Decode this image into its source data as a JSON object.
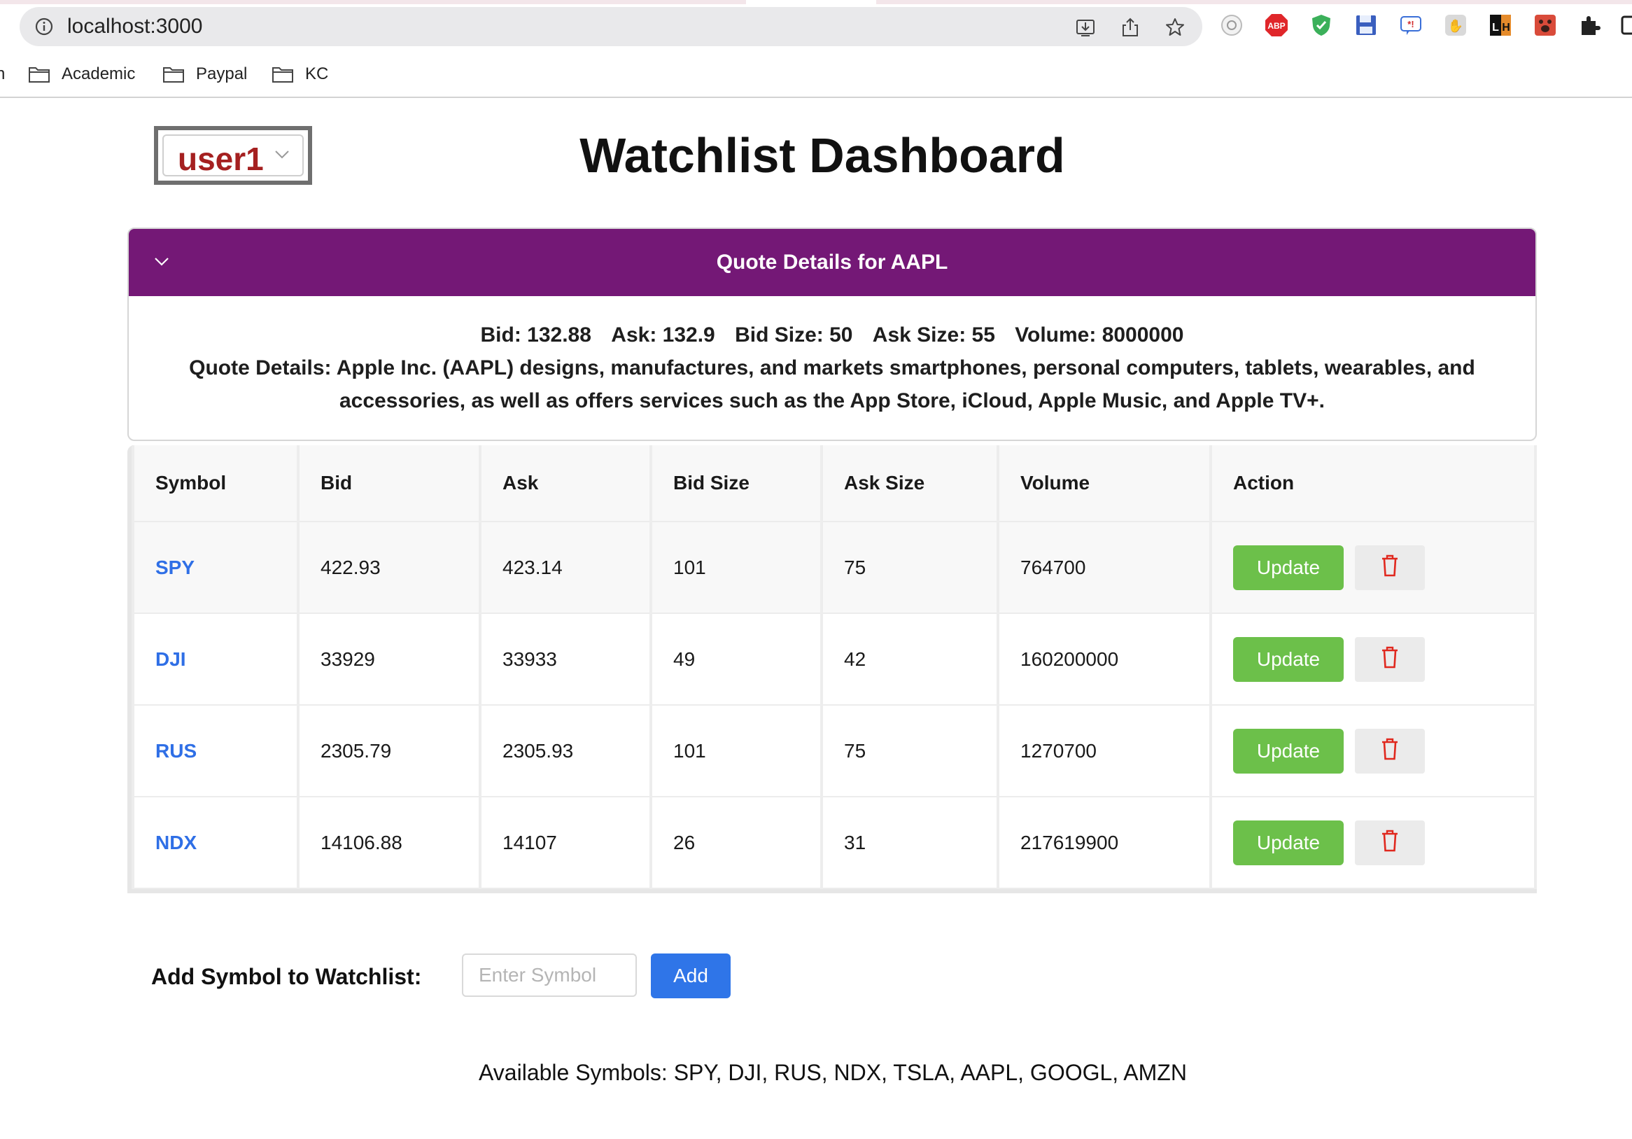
{
  "browser": {
    "url": "localhost:3000",
    "bookmarks": [
      {
        "label": "n"
      },
      {
        "label": "Academic"
      },
      {
        "label": "Paypal"
      },
      {
        "label": "KC"
      }
    ],
    "extensions": [
      "timer-icon",
      "adblock-icon",
      "shield-icon",
      "save-icon",
      "bookmark-star-icon",
      "hand-icon",
      "lighthouse-icon",
      "paw-icon",
      "puzzle-icon",
      "window-icon"
    ]
  },
  "page": {
    "user_select": {
      "value": "user1"
    },
    "title": "Watchlist Dashboard"
  },
  "quote_panel": {
    "title": "Quote Details for AAPL",
    "bid": "Bid: 132.88",
    "ask": "Ask: 132.9",
    "bid_size": "Bid Size: 50",
    "ask_size": "Ask Size: 55",
    "volume": "Volume: 8000000",
    "details": "Quote Details: Apple Inc. (AAPL) designs, manufactures, and markets smartphones, personal computers, tablets, wearables, and accessories, as well as offers services such as the App Store, iCloud, Apple Music, and Apple TV+."
  },
  "table": {
    "headers": [
      "Symbol",
      "Bid",
      "Ask",
      "Bid Size",
      "Ask Size",
      "Volume",
      "Action"
    ],
    "update_label": "Update",
    "rows": [
      {
        "symbol": "SPY",
        "bid": "422.93",
        "ask": "423.14",
        "bid_size": "101",
        "ask_size": "75",
        "volume": "764700"
      },
      {
        "symbol": "DJI",
        "bid": "33929",
        "ask": "33933",
        "bid_size": "49",
        "ask_size": "42",
        "volume": "160200000"
      },
      {
        "symbol": "RUS",
        "bid": "2305.79",
        "ask": "2305.93",
        "bid_size": "101",
        "ask_size": "75",
        "volume": "1270700"
      },
      {
        "symbol": "NDX",
        "bid": "14106.88",
        "ask": "14107",
        "bid_size": "26",
        "ask_size": "31",
        "volume": "217619900"
      }
    ]
  },
  "add_form": {
    "label": "Add Symbol to Watchlist:",
    "placeholder": "Enter Symbol",
    "value": "",
    "button": "Add"
  },
  "available_symbols": "Available Symbols: SPY, DJI, RUS, NDX, TSLA, AAPL, GOOGL, AMZN",
  "colors": {
    "header_purple": "#741876",
    "update_green": "#6cc04a",
    "add_blue": "#2f75e8",
    "symbol_blue": "#2f6fe6",
    "user_red": "#a52020",
    "delete_red": "#e0281e"
  }
}
